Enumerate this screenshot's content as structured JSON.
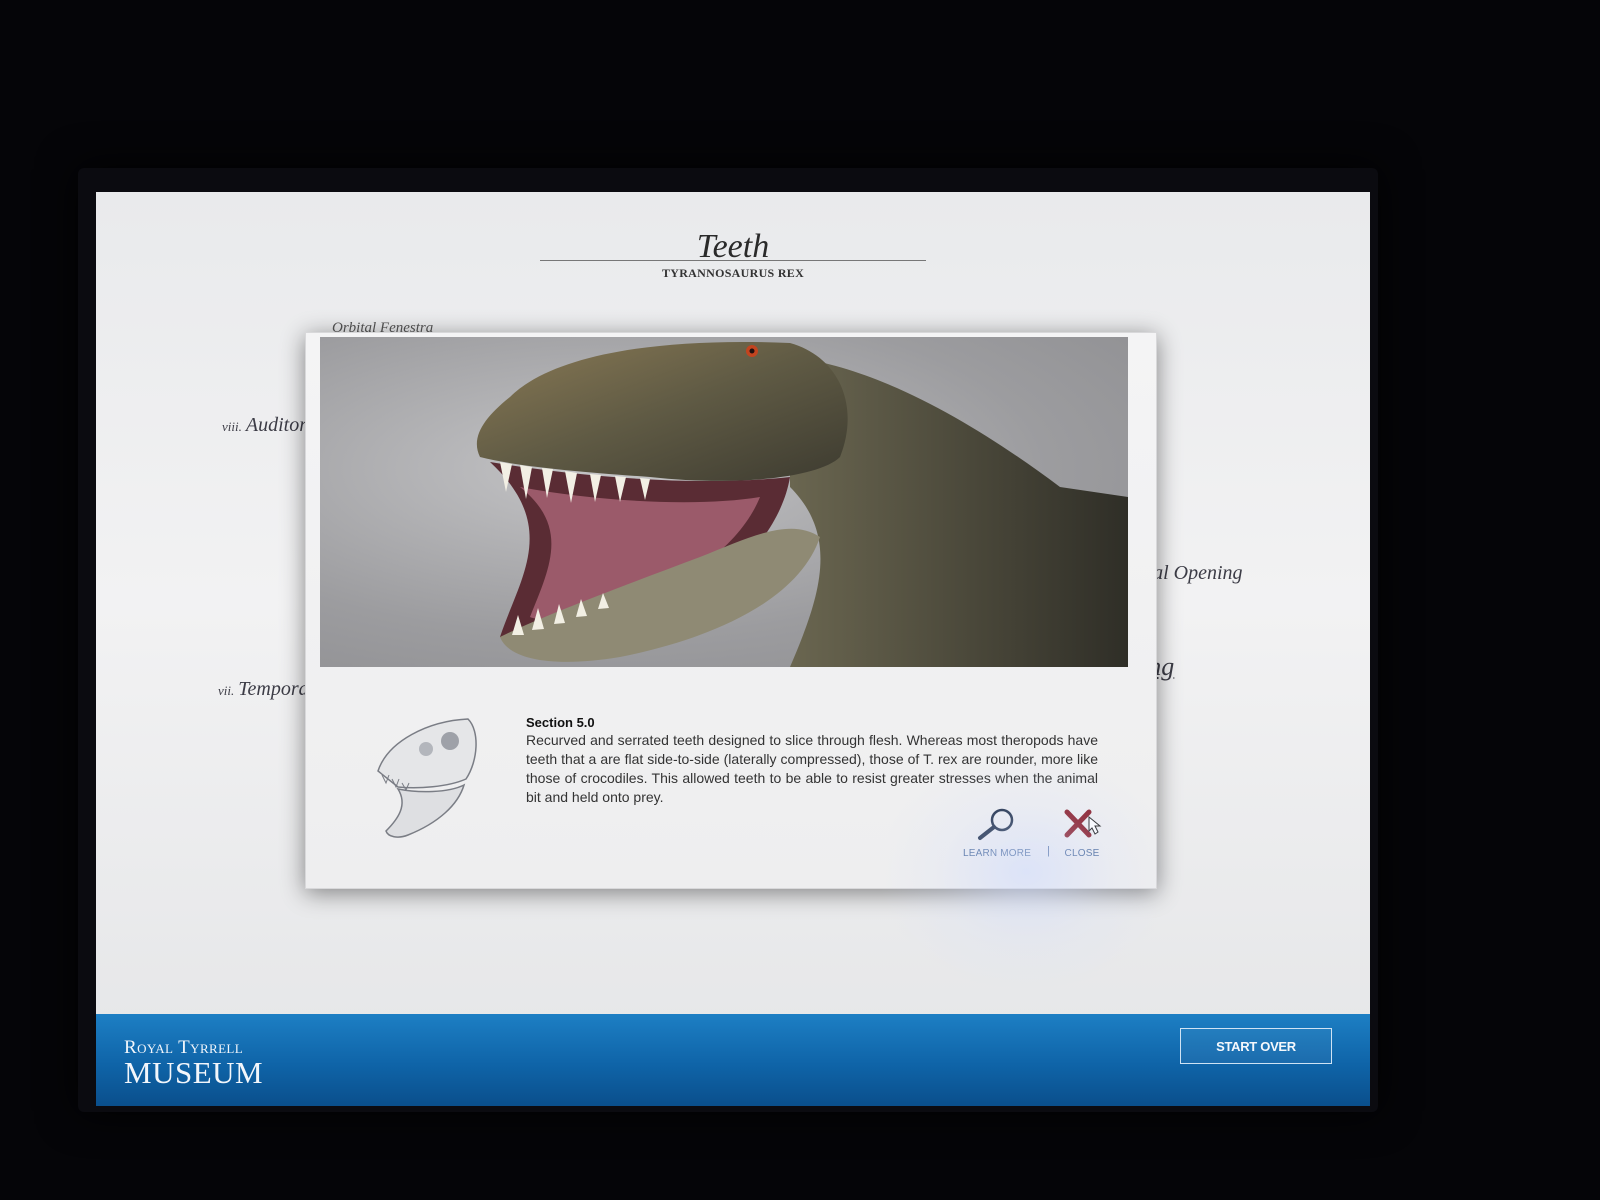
{
  "header": {
    "title": "Teeth",
    "subtitle": "TYRANNOSAURUS REX"
  },
  "background_labels": {
    "orbital": "Orbital Fenestra",
    "auditory": {
      "num": "viii.",
      "label": "Auditory"
    },
    "temporal": {
      "num": "vii.",
      "label": "Tempora"
    },
    "nasal": "Nasal Opening",
    "partial": "ding"
  },
  "modal": {
    "section_label": "Section 5.0",
    "body": "Recurved and serrated teeth designed to slice through flesh. Whereas most theropods have teeth that a are flat side-to-side (laterally compressed), those of T. rex are rounder, more like those of crocodiles. This allowed teeth to be able to resist greater stresses when the animal bit and held onto prey.",
    "learn_more_label": "LEARN MORE",
    "separator": "|",
    "close_label": "CLOSE",
    "icons": {
      "learn_more": "magnifier-icon",
      "close": "close-x-icon",
      "cursor": "hand-pointer-icon"
    }
  },
  "footer": {
    "brand_top": "Royal Tyrrell",
    "brand_bottom": "MUSEUM",
    "start_over_label": "START OVER"
  },
  "colors": {
    "footer_blue": "#1470b5",
    "close_x": "#8b1e2a",
    "caption_blue": "#4a6a9a"
  }
}
